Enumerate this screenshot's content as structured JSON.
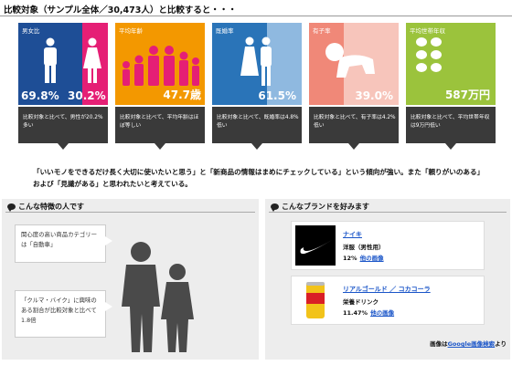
{
  "title": "比較対象（サンプル全体／30,473人）と比較すると・・・",
  "tiles": [
    {
      "label": "男女比",
      "male_value": "69.8%",
      "female_value": "30.2%",
      "note": "比較対象と比べて、男性が20.2%多い"
    },
    {
      "label": "平均年齢",
      "value": "47.7歳",
      "note": "比較対象と比べて、平均年齢はほぼ等しい"
    },
    {
      "label": "既婚率",
      "value": "61.5%",
      "note": "比較対象と比べて、既婚率は4.8%低い"
    },
    {
      "label": "有子率",
      "value": "39.0%",
      "note": "比較対象と比べて、有子率は4.2%低い"
    },
    {
      "label": "平均世帯年収",
      "value": "587万円",
      "note": "比較対象と比べて、平均世帯年収は9万円低い"
    }
  ],
  "summary": "「いいモノをできるだけ長く大切に使いたいと思う」と「新商品の情報はまめにチェックしている」という傾向が強い。また「頼りがいのある」および「見識がある」と思われたいと考えている。",
  "features": {
    "heading": "こんな特徴の人です",
    "callouts": [
      "関心度の高い商品カテゴリーは「自動車」",
      "「クルマ・バイク」に興味のある割合が比較対象と比べて1.8倍"
    ]
  },
  "brands": {
    "heading": "こんなブランドを好みます",
    "items": [
      {
        "name": "ナイキ",
        "category": "洋服（男性用）",
        "percent": "12%",
        "link_label": "他の画像"
      },
      {
        "name": "リアルゴールド ／ コカコーラ",
        "category": "栄養ドリンク",
        "percent": "11.47%",
        "link_label": "他の画像"
      }
    ]
  },
  "credit": {
    "prefix": "画像は",
    "link": "Google画像検索",
    "suffix": "より"
  },
  "colors": {
    "pink": "#e51f75",
    "orange": "#f39800",
    "blue": "#2a74b8",
    "salmon": "#f08878",
    "green": "#9bc33c",
    "navy": "#1e4e96"
  }
}
